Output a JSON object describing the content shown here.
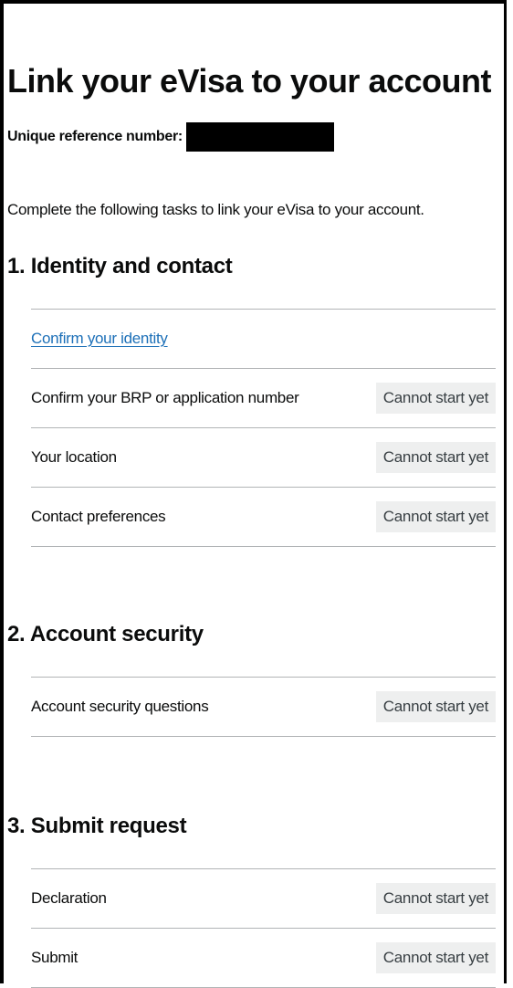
{
  "page": {
    "title": "Link your eVisa to your account",
    "reference_label": "Unique reference number:",
    "intro": "Complete the following tasks to link your eVisa to your account."
  },
  "sections": [
    {
      "heading": "1.  Identity and contact",
      "tasks": [
        {
          "label": "Confirm your identity",
          "status": ""
        },
        {
          "label": "Confirm your BRP or application number",
          "status": "Cannot start yet"
        },
        {
          "label": "Your location",
          "status": "Cannot start yet"
        },
        {
          "label": "Contact preferences",
          "status": "Cannot start yet"
        }
      ]
    },
    {
      "heading": "2. Account security",
      "tasks": [
        {
          "label": "Account security questions",
          "status": "Cannot start yet"
        }
      ]
    },
    {
      "heading": "3. Submit request",
      "tasks": [
        {
          "label": "Declaration",
          "status": "Cannot start yet"
        },
        {
          "label": "Submit",
          "status": "Cannot start yet"
        }
      ]
    }
  ],
  "colors": {
    "link": "#1d70b8",
    "status_tag_background": "#eeefef",
    "divider": "#b1b4b6"
  }
}
